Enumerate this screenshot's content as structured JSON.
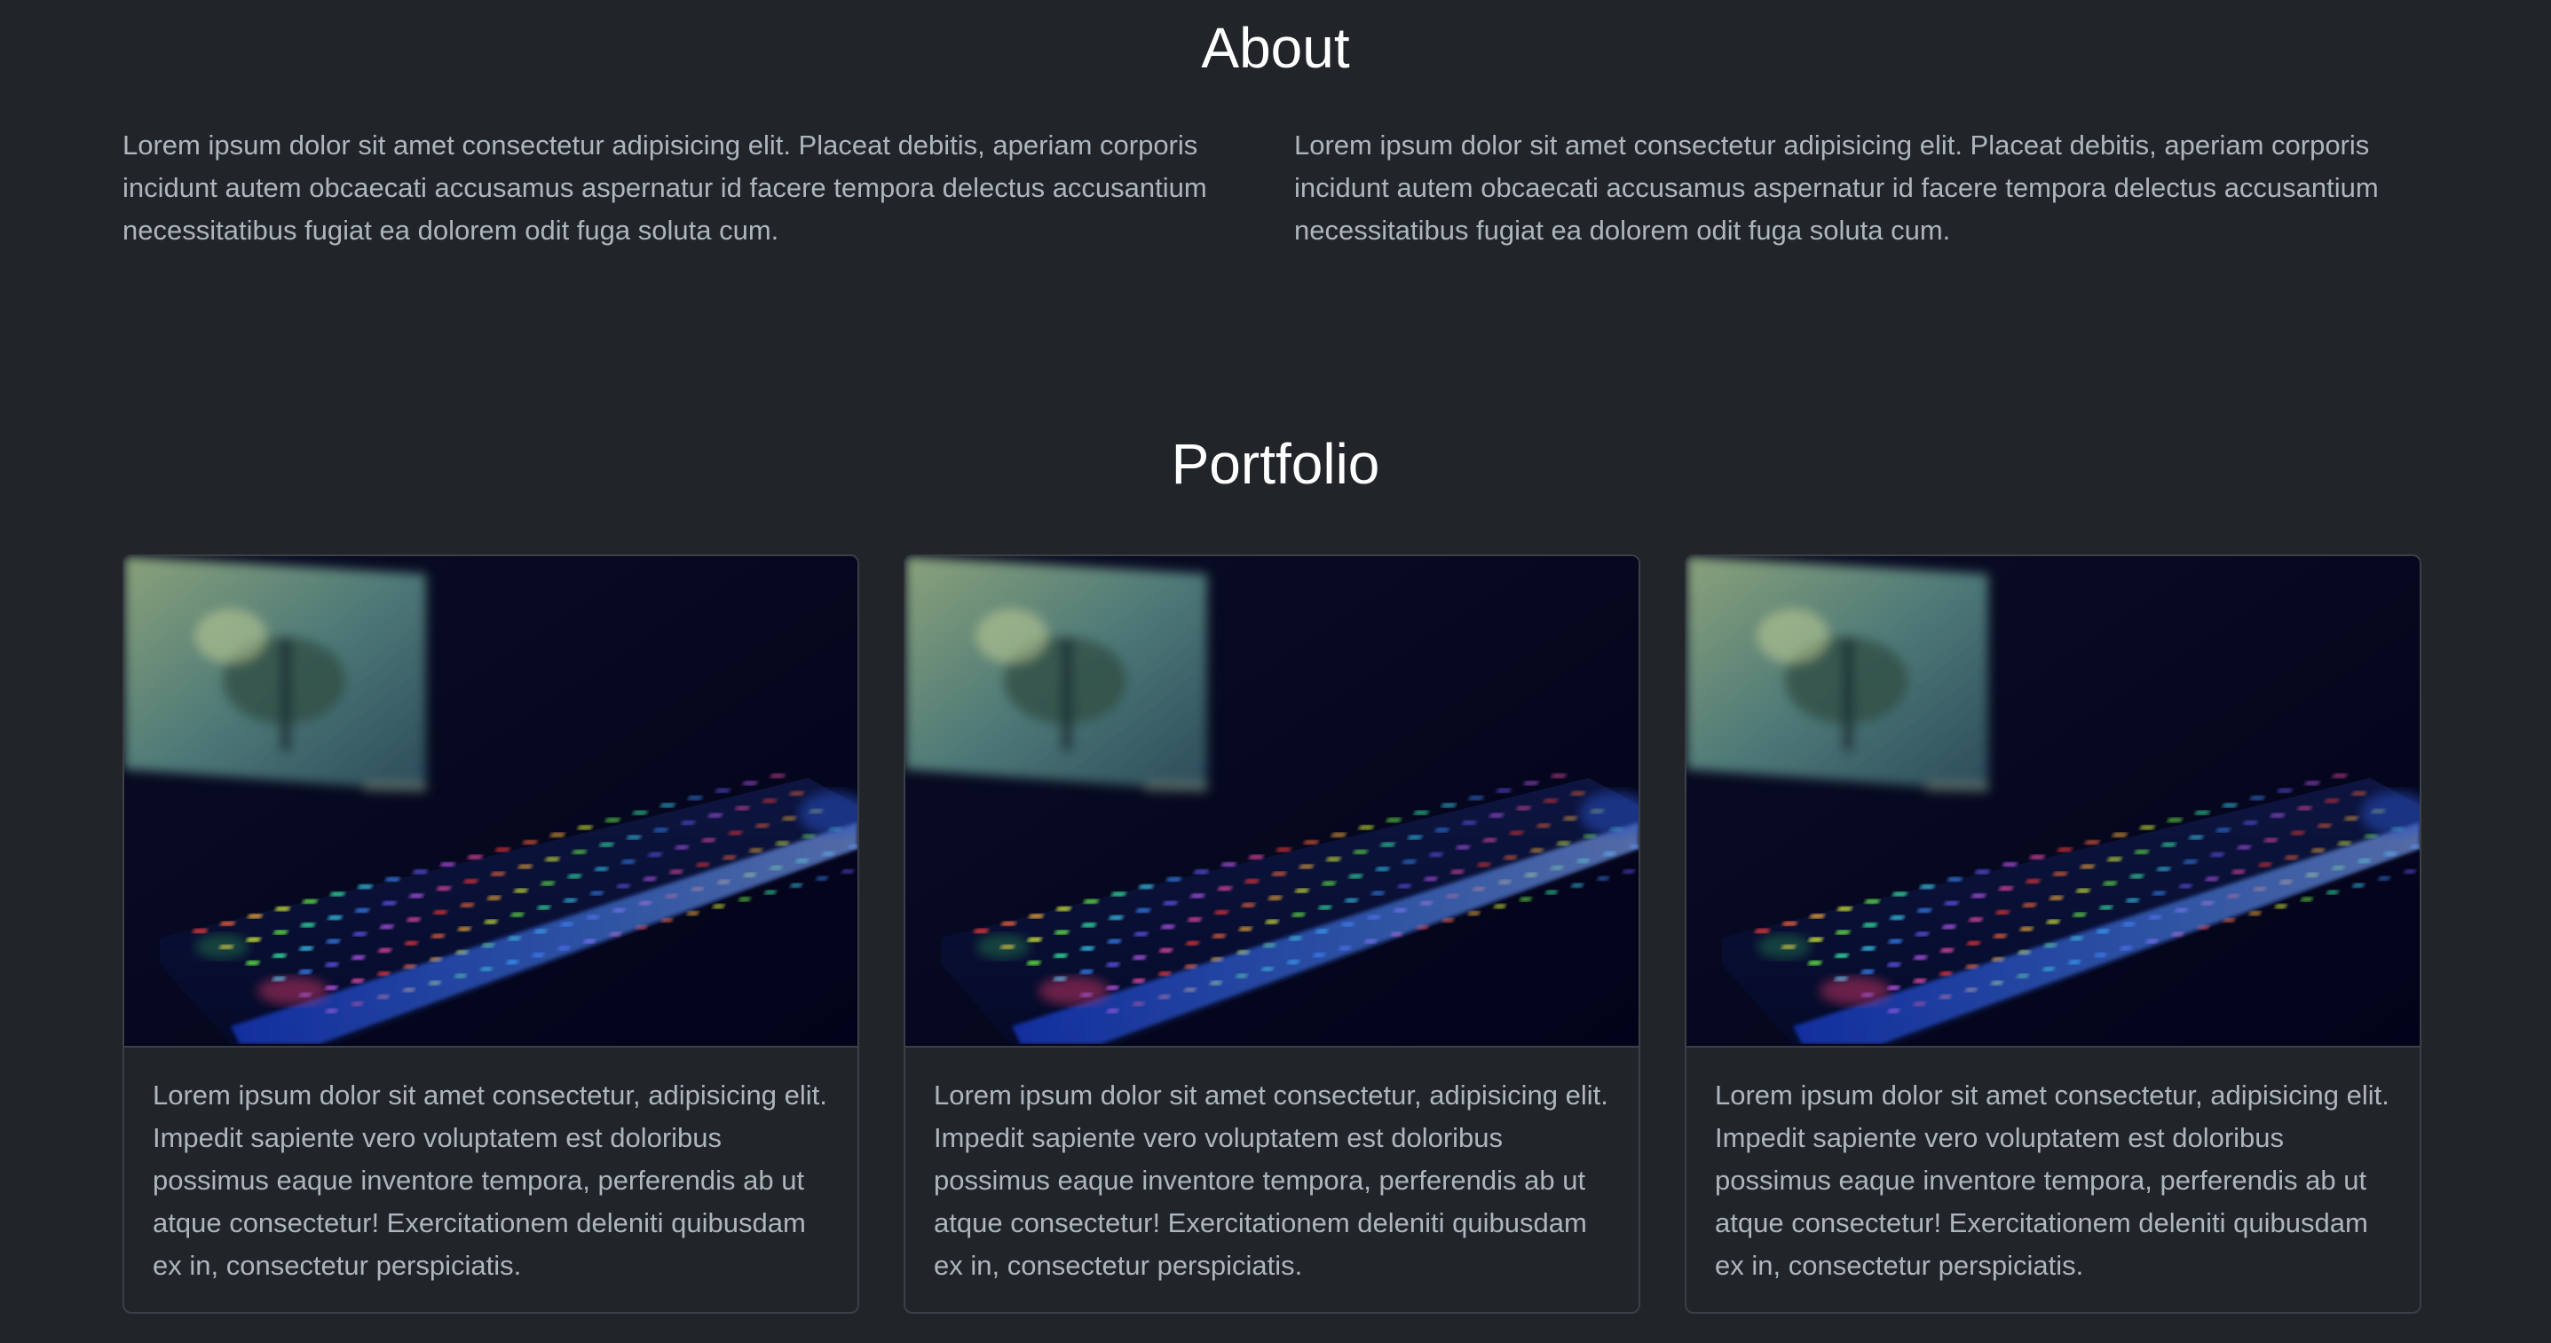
{
  "about": {
    "title": "About",
    "paragraph_left": "Lorem ipsum dolor sit amet consectetur adipisicing elit. Placeat debitis, aperiam corporis incidunt autem obcaecati accusamus aspernatur id facere tempora delectus accusantium necessitatibus fugiat ea dolorem odit fuga soluta cum.",
    "paragraph_right": "Lorem ipsum dolor sit amet consectetur adipisicing elit. Placeat debitis, aperiam corporis incidunt autem obcaecati accusamus aspernatur id facere tempora delectus accusantium necessitatibus fugiat ea dolorem odit fuga soluta cum."
  },
  "portfolio": {
    "title": "Portfolio",
    "cards": [
      {
        "image": "keyboard-photo",
        "text": "Lorem ipsum dolor sit amet consectetur, adipisicing elit. Impedit sapiente vero voluptatem est doloribus possimus eaque inventore tempora, perferendis ab ut atque consectetur! Exercitationem deleniti quibusdam ex in, consectetur perspiciatis."
      },
      {
        "image": "keyboard-photo",
        "text": "Lorem ipsum dolor sit amet consectetur, adipisicing elit. Impedit sapiente vero voluptatem est doloribus possimus eaque inventore tempora, perferendis ab ut atque consectetur! Exercitationem deleniti quibusdam ex in, consectetur perspiciatis."
      },
      {
        "image": "keyboard-photo",
        "text": "Lorem ipsum dolor sit amet consectetur, adipisicing elit. Impedit sapiente vero voluptatem est doloribus possimus eaque inventore tempora, perferendis ab ut atque consectetur! Exercitationem deleniti quibusdam ex in, consectetur perspiciatis."
      }
    ]
  },
  "colors": {
    "background": "#212529",
    "heading": "#ffffff",
    "body_text": "#adb5bd",
    "card_border": "#3b4046"
  }
}
